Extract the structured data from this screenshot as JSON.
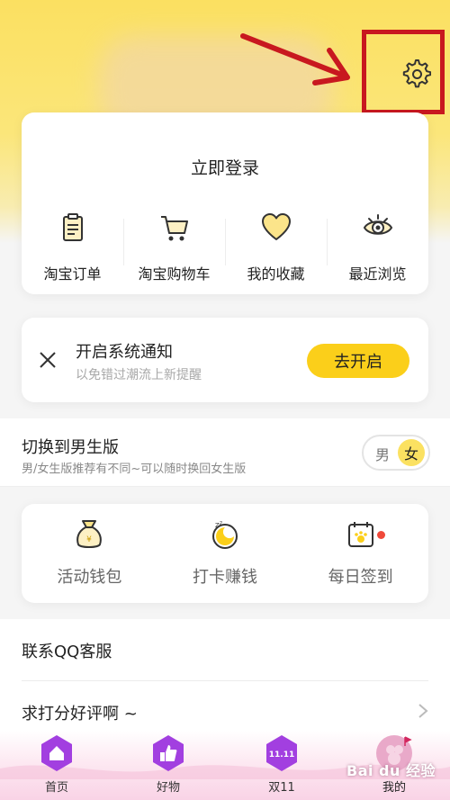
{
  "header": {
    "login_text": "立即登录"
  },
  "quick_links": [
    {
      "label": "淘宝订单",
      "icon": "clipboard-icon"
    },
    {
      "label": "淘宝购物车",
      "icon": "cart-icon"
    },
    {
      "label": "我的收藏",
      "icon": "heart-icon"
    },
    {
      "label": "最近浏览",
      "icon": "eye-icon"
    }
  ],
  "notice": {
    "title": "开启系统通知",
    "subtitle": "以免错过潮流上新提醒",
    "button": "去开启"
  },
  "gender": {
    "title": "切换到男生版",
    "subtitle": "男/女生版推荐有不同~可以随时换回女生版",
    "male": "男",
    "female": "女"
  },
  "activities": [
    {
      "label": "活动钱包",
      "icon": "money-bag-icon"
    },
    {
      "label": "打卡赚钱",
      "icon": "alarm-clock-icon"
    },
    {
      "label": "每日签到",
      "icon": "calendar-paw-icon"
    }
  ],
  "list": {
    "qq_service": "联系QQ客服",
    "rate": "求打分好评啊 ~"
  },
  "tabs": [
    {
      "label": "首页",
      "icon": "home-icon"
    },
    {
      "label": "好物",
      "icon": "thumbs-up-icon"
    },
    {
      "label": "双11",
      "icon": "double-eleven-icon"
    },
    {
      "label": "我的",
      "icon": "avatar-icon"
    }
  ],
  "tab_badge_text": "11.11",
  "watermark": "Bai du 经验",
  "colors": {
    "accent_yellow": "#fbcf1a",
    "tab_purple": "#9b2fd6",
    "annotation_red": "#c8181f"
  }
}
